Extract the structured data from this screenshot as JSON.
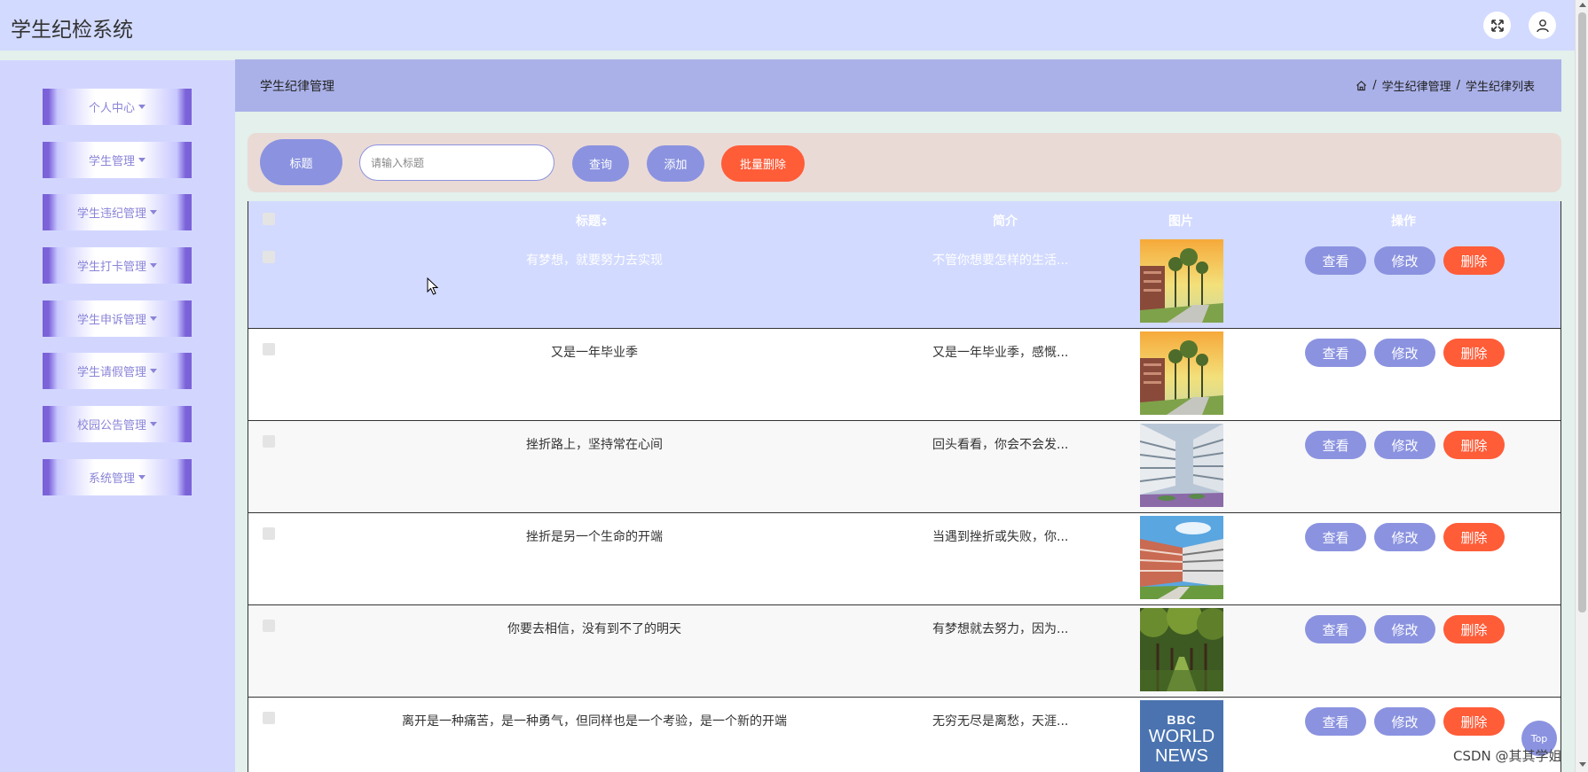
{
  "app": {
    "title": "学生纪检系统"
  },
  "header": {
    "fullscreen_icon": "expand-icon",
    "user_icon": "user-icon"
  },
  "sidebar": {
    "items": [
      {
        "label": "个人中心"
      },
      {
        "label": "学生管理"
      },
      {
        "label": "学生违纪管理"
      },
      {
        "label": "学生打卡管理"
      },
      {
        "label": "学生申诉管理"
      },
      {
        "label": "学生请假管理"
      },
      {
        "label": "校园公告管理"
      },
      {
        "label": "系统管理"
      }
    ]
  },
  "breadcrumb": {
    "page_title": "学生纪律管理",
    "home_icon": "home-icon",
    "sep": "/",
    "level1": "学生纪律管理",
    "level2": "学生纪律列表"
  },
  "search": {
    "label": "标题",
    "placeholder": "请输入标题",
    "value": "",
    "query_label": "查询",
    "add_label": "添加",
    "batch_delete_label": "批量删除"
  },
  "table": {
    "headers": {
      "title": "标题",
      "sort_icon": "sort-icon",
      "intro": "简介",
      "image": "图片",
      "actions": "操作"
    },
    "action_labels": {
      "view": "查看",
      "edit": "修改",
      "delete": "删除"
    },
    "rows": [
      {
        "title": "有梦想，就要努力去实现",
        "intro": "不管你想要怎样的生活...",
        "image": "campus-sunset-photo",
        "highlighted": true
      },
      {
        "title": "又是一年毕业季",
        "intro": "又是一年毕业季，感慨...",
        "image": "campus-sunset-photo",
        "highlighted": false
      },
      {
        "title": "挫折路上，坚持常在心间",
        "intro": "回头看看，你会不会发...",
        "image": "campus-courtyard-photo",
        "highlighted": false
      },
      {
        "title": "挫折是另一个生命的开端",
        "intro": "当遇到挫折或失败，你...",
        "image": "campus-building-photo",
        "highlighted": false
      },
      {
        "title": "你要去相信，没有到不了的明天",
        "intro": "有梦想就去努力，因为...",
        "image": "tree-path-photo",
        "highlighted": false
      },
      {
        "title": "离开是一种痛苦，是一种勇气，但同样也是一个考验，是一个新的开端",
        "intro": "无穷无尽是离愁，天涯...",
        "image": "bbc-world-news-logo",
        "highlighted": false
      }
    ]
  },
  "bbc_logo": {
    "line1": "BBC",
    "line2": "WORLD",
    "line3": "NEWS"
  },
  "top_button": {
    "label": "Top"
  },
  "watermark": {
    "text": "CSDN @其其学姐"
  },
  "colors": {
    "accent": "#8b93e0",
    "danger": "#ff5c38",
    "header_bg": "#d2daff",
    "sidebar_bg": "#d2d6ff"
  }
}
